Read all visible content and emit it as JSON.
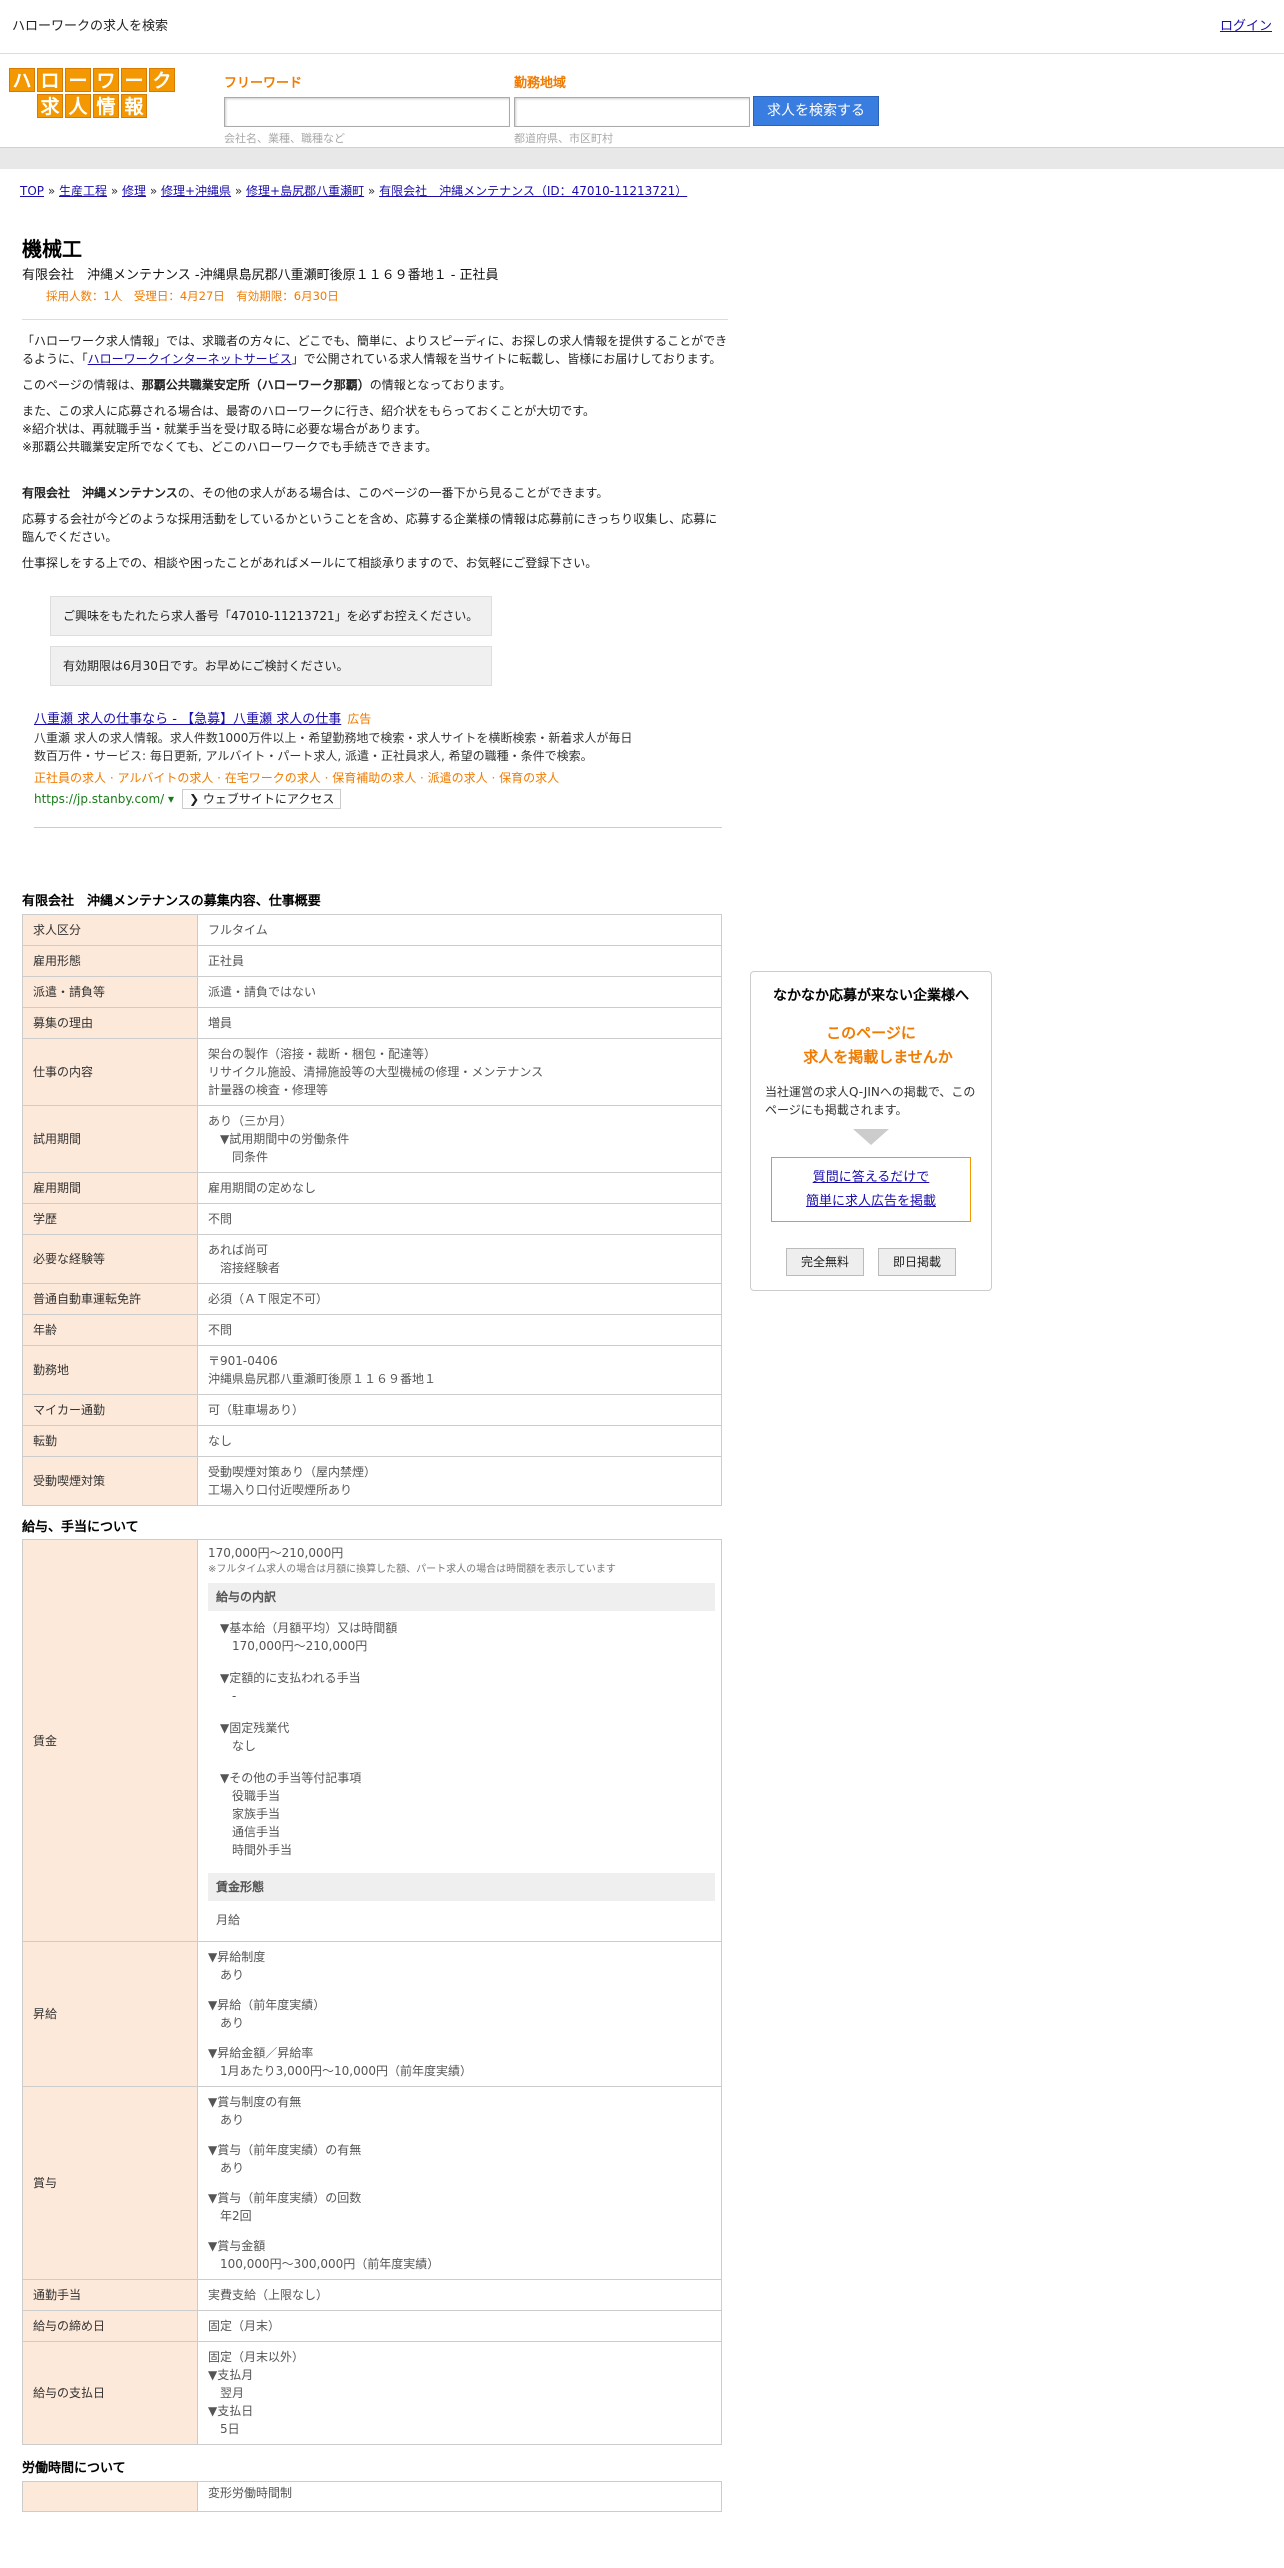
{
  "topbar": {
    "title": "ハローワークの求人を検索",
    "login": "ログイン"
  },
  "logo": {
    "row1": [
      "ハ",
      "ロ",
      "ー",
      "ワ",
      "ー",
      "ク"
    ],
    "row2": [
      "求",
      "人",
      "情",
      "報"
    ]
  },
  "search": {
    "keyword_label": "フリーワード",
    "keyword_placeholder": "会社名、業種、職種など",
    "area_label": "勤務地域",
    "area_placeholder": "都道府県、市区町村",
    "button": "求人を検索する"
  },
  "breadcrumb": [
    "TOP",
    "生産工程",
    "修理",
    "修理+沖縄県",
    "修理+島尻郡八重瀬町",
    "有限会社　沖縄メンテナンス（ID：47010-11213721）"
  ],
  "job": {
    "title": "機械工",
    "company_line": "有限会社　沖縄メンテナンス -沖縄県島尻郡八重瀬町後原１１６９番地１ - 正社員",
    "meta": "採用人数：1人　受理日：4月27日　有効期限：6月30日"
  },
  "intro": {
    "p1a": "「ハローワーク求人情報」では、求職者の方々に、どこでも、簡単に、よりスピーディに、お探しの求人情報を提供することができるように、「",
    "p1link": "ハローワークインターネットサービス",
    "p1b": "」で公開されている求人情報を当サイトに転載し、皆様にお届けしております。",
    "p2a": "このページの情報は、",
    "p2b": "那覇公共職業安定所（ハローワーク那覇）",
    "p2c": "の情報となっております。",
    "p3": "また、この求人に応募される場合は、最寄のハローワークに行き、紹介状をもらっておくことが大切です。",
    "p4": "※紹介状は、再就職手当・就業手当を受け取る時に必要な場合があります。",
    "p5": "※那覇公共職業安定所でなくても、どこのハローワークでも手続きできます。",
    "p6a": "有限会社　沖縄メンテナンス",
    "p6b": "の、その他の求人がある場合は、このページの一番下から見ることができます。",
    "p7": "応募する会社が今どのような採用活動をしているかということを含め、応募する企業様の情報は応募前にきっちり収集し、応募に臨んでください。",
    "p8": "仕事探しをする上での、相談や困ったことがあればメールにて相談承りますので、お気軽にご登録下さい。"
  },
  "notices": [
    "ご興味をもたれたら求人番号「47010-11213721」を必ずお控えください。",
    "有効期限は6月30日です。お早めにご検討ください。"
  ],
  "ad": {
    "headline": "八重瀬 求人の仕事なら - 【急募】八重瀬 求人の仕事",
    "tag": "広告",
    "desc": "八重瀬 求人の求人情報。求人件数1000万件以上・希望勤務地で検索・求人サイトを横断検索・新着求人が毎日数百万件・サービス: 毎日更新, アルバイト・パート求人, 派遣・正社員求人, 希望の職種・条件で検索。",
    "links": "正社員の求人 · アルバイトの求人 · 在宅ワークの求人 · 保育補助の求人 · 派遣の求人 · 保育の求人",
    "url": "https://jp.stanby.com/",
    "url_arrow": "▾",
    "visit": "❯ ウェブサイトにアクセス"
  },
  "sections": {
    "overview": "有限会社　沖縄メンテナンスの募集内容、仕事概要",
    "salary": "給与、手当について",
    "hours": "労働時間について"
  },
  "overview": [
    {
      "k": "求人区分",
      "v": [
        "フルタイム"
      ]
    },
    {
      "k": "雇用形態",
      "v": [
        "正社員"
      ]
    },
    {
      "k": "派遣・請負等",
      "v": [
        "派遣・請負ではない"
      ]
    },
    {
      "k": "募集の理由",
      "v": [
        "増員"
      ]
    },
    {
      "k": "仕事の内容",
      "v": [
        "架台の製作（溶接・裁断・梱包・配達等）",
        "リサイクル施設、清掃施設等の大型機械の修理・メンテナンス",
        "計量器の検査・修理等"
      ]
    },
    {
      "k": "試用期間",
      "v": [
        "あり（三か月）",
        "　▼試用期間中の労働条件",
        "　　同条件"
      ]
    },
    {
      "k": "雇用期間",
      "v": [
        "雇用期間の定めなし"
      ]
    },
    {
      "k": "学歴",
      "v": [
        "不問"
      ]
    },
    {
      "k": "必要な経験等",
      "v": [
        "あれば尚可",
        "　溶接経験者"
      ]
    },
    {
      "k": "普通自動車運転免許",
      "v": [
        "必須（ＡＴ限定不可）"
      ]
    },
    {
      "k": "年齢",
      "v": [
        "不問"
      ]
    },
    {
      "k": "勤務地",
      "v": [
        "〒901-0406",
        "沖縄県島尻郡八重瀬町後原１１６９番地１"
      ]
    },
    {
      "k": "マイカー通勤",
      "v": [
        "可（駐車場あり）"
      ]
    },
    {
      "k": "転勤",
      "v": [
        "なし"
      ]
    },
    {
      "k": "受動喫煙対策",
      "v": [
        "受動喫煙対策あり（屋内禁煙）",
        "工場入り口付近喫煙所あり"
      ]
    }
  ],
  "salary": {
    "wage_key": "賃金",
    "wage_range": "170,000円〜210,000円",
    "wage_note": "※フルタイム求人の場合は月額に換算した額、パート求人の場合は時間額を表示しています",
    "breakdown_label": "給与の内訳",
    "breakdown": [
      [
        "　▼基本給（月額平均）又は時間額",
        "　　170,000円〜210,000円"
      ],
      [
        "　▼定額的に支払われる手当",
        "　　-"
      ],
      [
        "　▼固定残業代",
        "　　なし"
      ],
      [
        "　▼その他の手当等付記事項",
        "　　役職手当",
        "　　家族手当",
        "　　通信手当",
        "　　時間外手当"
      ]
    ],
    "form_label": "賃金形態",
    "form_value": "月給",
    "raise_key": "昇給",
    "raise": [
      [
        "▼昇給制度",
        "　あり"
      ],
      [
        "▼昇給（前年度実績）",
        "　あり"
      ],
      [
        "▼昇給金額／昇給率",
        "　1月あたり3,000円〜10,000円（前年度実績）"
      ]
    ],
    "bonus_key": "賞与",
    "bonus": [
      [
        "▼賞与制度の有無",
        "　あり"
      ],
      [
        "▼賞与（前年度実績）の有無",
        "　あり"
      ],
      [
        "▼賞与（前年度実績）の回数",
        "　年2回"
      ],
      [
        "▼賞与金額",
        "　100,000円〜300,000円（前年度実績）"
      ]
    ],
    "commute_key": "通勤手当",
    "commute": "実費支給（上限なし）",
    "close_key": "給与の締め日",
    "close": "固定（月末）",
    "pay_key": "給与の支払日",
    "pay": [
      "固定（月末以外）",
      "▼支払月",
      "　翌月",
      "▼支払日",
      "　5日"
    ]
  },
  "hours_first": "変形労働時間制",
  "side": {
    "title": "なかなか応募が来ない企業様へ",
    "catch1": "このページに",
    "catch2": "求人を掲載しませんか",
    "desc": "当社運営の求人Q-JINへの掲載で、このページにも掲載されます。",
    "link1": "質問に答えるだけで",
    "link2": "簡単に求人広告を掲載",
    "btn1": "完全無料",
    "btn2": "即日掲載"
  }
}
